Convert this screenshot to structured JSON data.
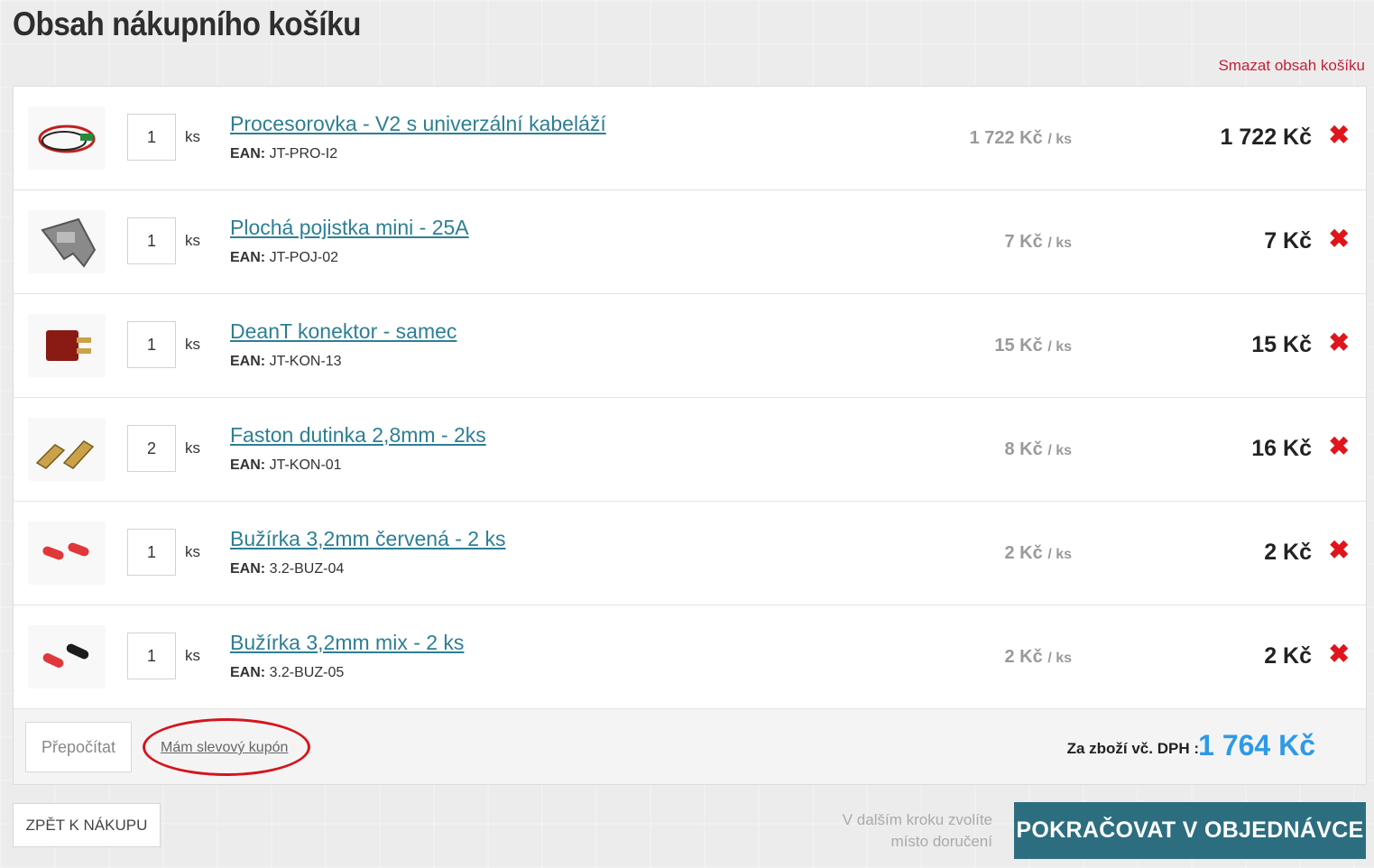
{
  "page": {
    "title": "Obsah nákupního košíku",
    "clear_cart_label": "Smazat obsah košíku"
  },
  "cart": {
    "items": [
      {
        "image_icon": "wire-harness-icon",
        "quantity": "1",
        "unit": "ks",
        "name": "Procesorovka - V2 s univerzální kabeláží",
        "ean_label": "EAN:",
        "ean": "JT-PRO-I2",
        "unit_price": "1 722 Kč",
        "per_unit": "/ ks",
        "total": "1 722 Kč"
      },
      {
        "image_icon": "blade-fuse-icon",
        "quantity": "1",
        "unit": "ks",
        "name": "Plochá pojistka mini - 25A",
        "ean_label": "EAN:",
        "ean": "JT-POJ-02",
        "unit_price": "7 Kč",
        "per_unit": "/ ks",
        "total": "7 Kč"
      },
      {
        "image_icon": "deans-connector-icon",
        "quantity": "1",
        "unit": "ks",
        "name": "DeanT konektor - samec",
        "ean_label": "EAN:",
        "ean": "JT-KON-13",
        "unit_price": "15 Kč",
        "per_unit": "/ ks",
        "total": "15 Kč"
      },
      {
        "image_icon": "faston-terminal-icon",
        "quantity": "2",
        "unit": "ks",
        "name": "Faston dutinka 2,8mm - 2ks",
        "ean_label": "EAN:",
        "ean": "JT-KON-01",
        "unit_price": "8 Kč",
        "per_unit": "/ ks",
        "total": "16 Kč"
      },
      {
        "image_icon": "shrink-tube-red-icon",
        "quantity": "1",
        "unit": "ks",
        "name": "Bužírka 3,2mm červená - 2 ks",
        "ean_label": "EAN:",
        "ean": "3.2-BUZ-04",
        "unit_price": "2 Kč",
        "per_unit": "/ ks",
        "total": "2 Kč"
      },
      {
        "image_icon": "shrink-tube-mix-icon",
        "quantity": "1",
        "unit": "ks",
        "name": "Bužírka 3,2mm mix - 2 ks",
        "ean_label": "EAN:",
        "ean": "3.2-BUZ-05",
        "unit_price": "2 Kč",
        "per_unit": "/ ks",
        "total": "2 Kč"
      }
    ],
    "remove_symbol": "✖",
    "recalculate_label": "Přepočítat",
    "coupon_label": "Mám slevový kupón",
    "total_label": "Za zboží vč. DPH :",
    "total_value": "1 764 Kč"
  },
  "actions": {
    "back_label": "ZPĚT K NÁKUPU",
    "hint_line1": "V dalším kroku zvolíte",
    "hint_line2": "místo doručení",
    "continue_label": "POKRAČOVAT V OBJEDNÁVCE"
  },
  "colors": {
    "link": "#2d7f93",
    "remove": "#e0151b",
    "total": "#2e9ae6",
    "primary_button": "#2c6e80",
    "danger_link": "#c4203a",
    "highlight_ring": "#d4161c"
  }
}
